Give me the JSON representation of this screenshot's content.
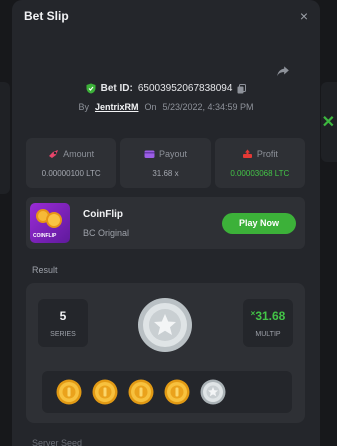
{
  "header": {
    "title": "Bet Slip",
    "close": "×"
  },
  "bet": {
    "id_label": "Bet ID:",
    "id_value": "65003952067838094",
    "by_label": "By",
    "user": "JentrixRM",
    "on_label": "On",
    "datetime": "5/23/2022, 4:34:59 PM"
  },
  "stats": [
    {
      "label": "Amount",
      "value": "0.00000100 LTC",
      "icon": "amount-icon"
    },
    {
      "label": "Payout",
      "value": "31.68 x",
      "icon": "payout-icon"
    },
    {
      "label": "Profit",
      "value": "0.00003068 LTC",
      "icon": "profit-icon"
    }
  ],
  "game": {
    "name": "CoinFlip",
    "subtitle": "BC Original",
    "thumb_text": "COINFLIP",
    "play_label": "Play Now"
  },
  "result": {
    "label": "Result",
    "series_value": "5",
    "series_label": "SERIES",
    "multip_prefix": "×",
    "multip_value": "31.68",
    "multip_label": "MULTIP",
    "coins": [
      "gold",
      "gold",
      "gold",
      "gold",
      "silver"
    ]
  },
  "footer": {
    "text": "Server Seed"
  },
  "colors": {
    "accent_green": "#3cb139",
    "profit_green": "#43c447",
    "panel": "#24262b",
    "card": "#2e3035"
  }
}
